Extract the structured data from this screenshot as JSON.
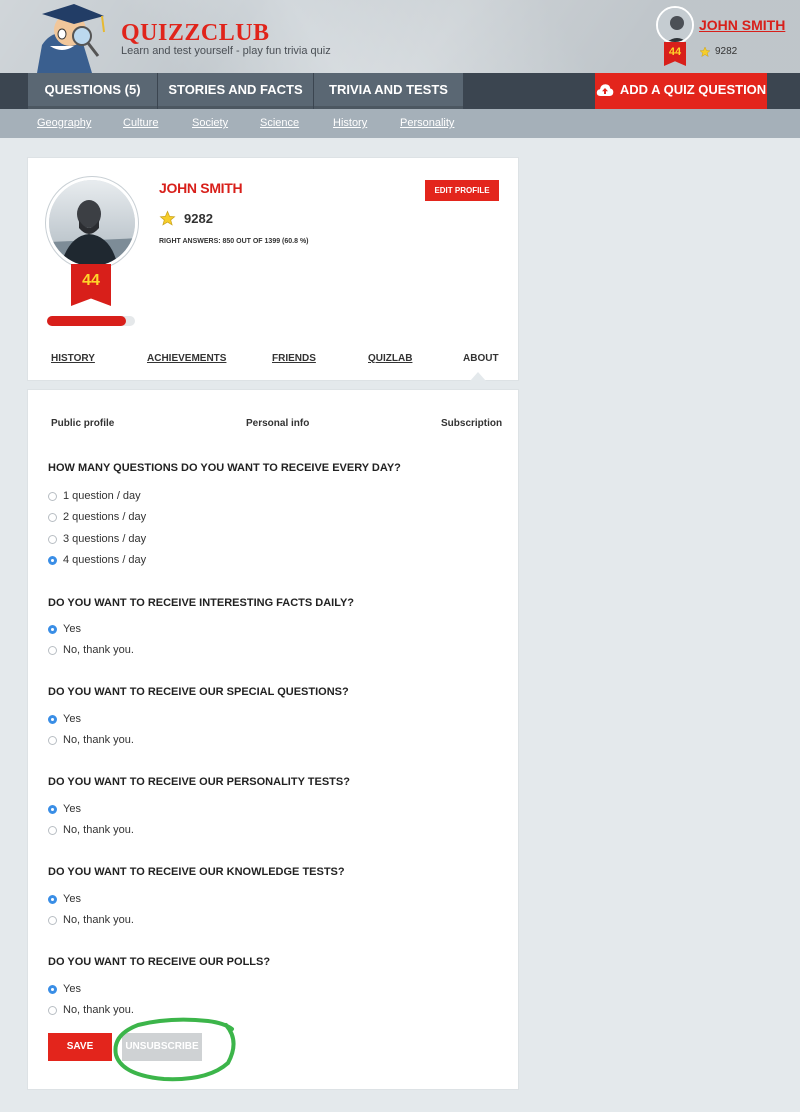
{
  "header": {
    "logo_title": "QUIZZCLUB",
    "logo_tagline": "Learn and test yourself - play fun trivia quiz",
    "user_name": "JOHN SMITH",
    "user_level": "44",
    "user_score": "9282"
  },
  "main_nav": {
    "questions": "QUESTIONS (5)",
    "stories": "STORIES AND FACTS",
    "trivia": "TRIVIA AND TESTS",
    "add_question": "ADD A QUIZ QUESTION"
  },
  "sub_nav": [
    "Geography",
    "Culture",
    "Society",
    "Science",
    "History",
    "Personality"
  ],
  "profile": {
    "name": "JOHN SMITH",
    "level": "44",
    "score": "9282",
    "right_answers": "RIGHT ANSWERS: 850 OUT OF 1399 (60.8 %)",
    "edit_label": "EDIT PROFILE",
    "level_progress": 0.9,
    "tabs": [
      "HISTORY",
      "ACHIEVEMENTS",
      "FRIENDS",
      "QUIZLAB",
      "ABOUT"
    ],
    "active_tab": "ABOUT"
  },
  "settings": {
    "subtabs": [
      "Public profile",
      "Personal info",
      "Subscription"
    ],
    "questions": [
      {
        "text": "HOW MANY QUESTIONS DO YOU WANT TO RECEIVE EVERY DAY?",
        "options": [
          "1 question / day",
          "2 questions / day",
          "3 questions / day",
          "4 questions / day"
        ],
        "selected": 3
      },
      {
        "text": "DO YOU WANT TO RECEIVE INTERESTING FACTS DAILY?",
        "options": [
          "Yes",
          "No, thank you."
        ],
        "selected": 0
      },
      {
        "text": "DO YOU WANT TO RECEIVE OUR SPECIAL QUESTIONS?",
        "options": [
          "Yes",
          "No, thank you."
        ],
        "selected": 0
      },
      {
        "text": "DO YOU WANT TO RECEIVE OUR PERSONALITY TESTS?",
        "options": [
          "Yes",
          "No, thank you."
        ],
        "selected": 0
      },
      {
        "text": "DO YOU WANT TO RECEIVE OUR KNOWLEDGE TESTS?",
        "options": [
          "Yes",
          "No, thank you."
        ],
        "selected": 0
      },
      {
        "text": "DO YOU WANT TO RECEIVE OUR POLLS?",
        "options": [
          "Yes",
          "No, thank you."
        ],
        "selected": 0
      }
    ],
    "save_label": "SAVE",
    "unsubscribe_label": "UNSUBSCRIBE"
  },
  "colors": {
    "brand_red": "#e3251c",
    "nav_dark": "#3b4550",
    "radio_blue": "#3a8ee6",
    "highlight_green": "#3cb54a"
  }
}
